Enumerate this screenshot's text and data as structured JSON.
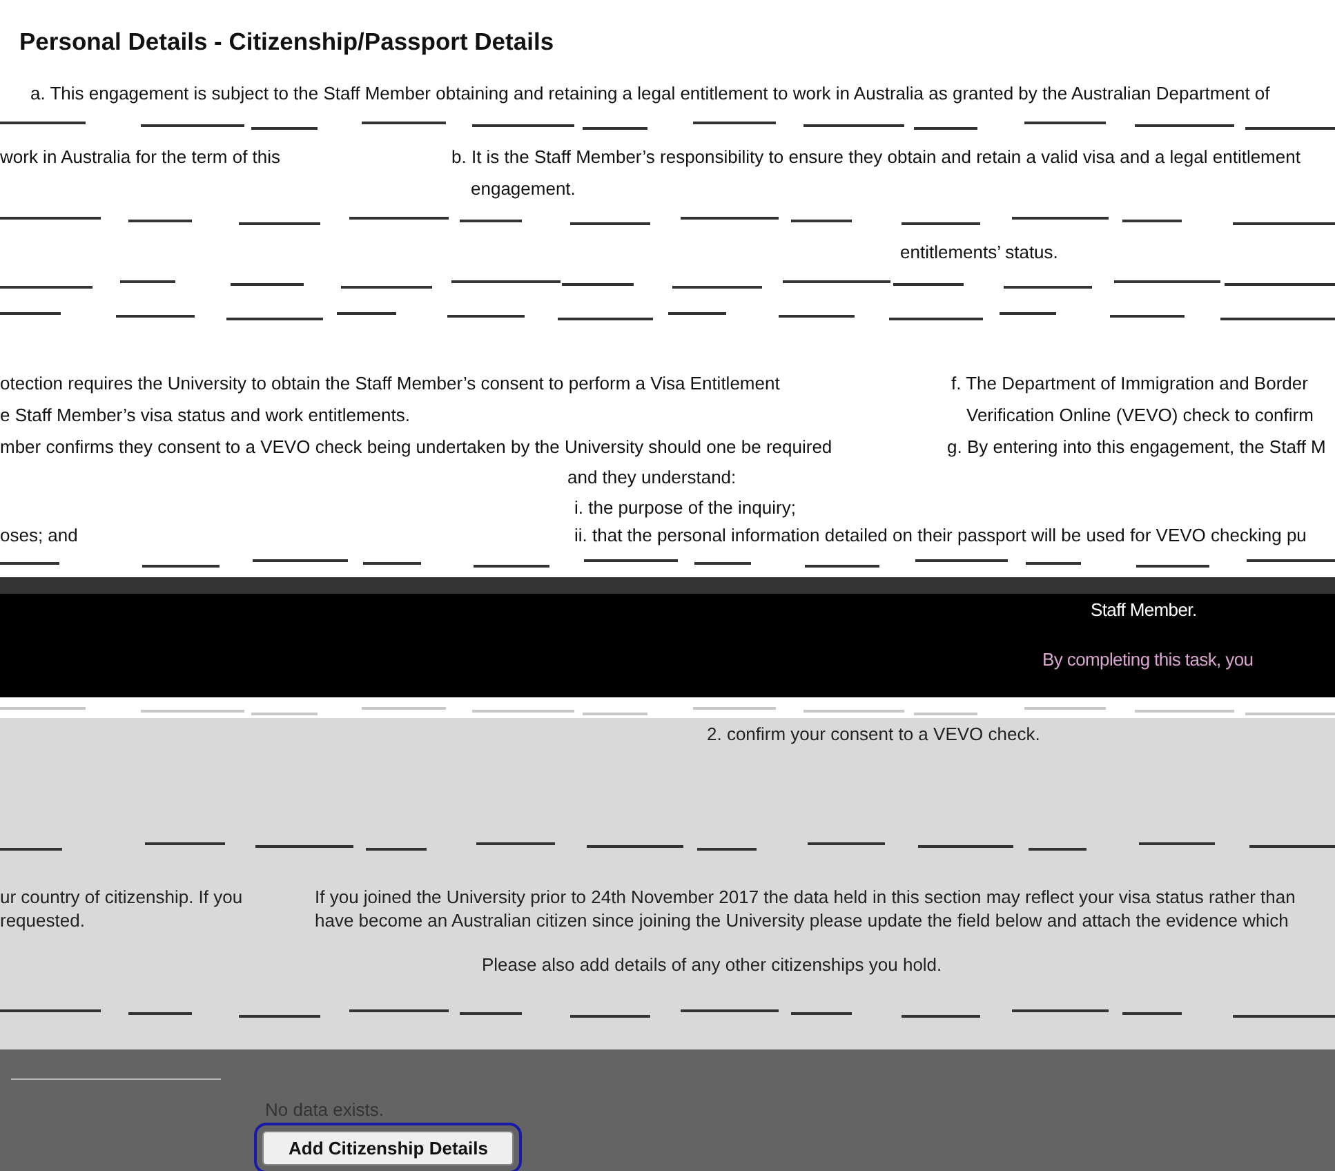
{
  "title": "Personal Details - Citizenship/Passport Details",
  "terms": [
    {
      "kind": "text",
      "segments": [
        "a. This engagement is subject to the Staff Member obtaining and retaining a legal entitlement to work in Australia as granted by the Australian Department of"
      ]
    },
    {
      "kind": "garbled"
    },
    {
      "kind": "text",
      "segments": [
        "work in Australia for the term of this",
        "b. It is the Staff Member’s responsibility to ensure they obtain and retain a valid visa and a legal entitlement"
      ]
    },
    {
      "kind": "text",
      "segments": [
        "engagement."
      ]
    },
    {
      "kind": "garbled"
    },
    {
      "kind": "text",
      "segments": [
        "entitlements’ status."
      ]
    },
    {
      "kind": "garbled"
    },
    {
      "kind": "garbled"
    },
    {
      "kind": "text",
      "segments": [
        "otection requires the University to obtain the Staff Member’s consent to perform a Visa Entitlement",
        "f. The Department of Immigration and Border"
      ]
    },
    {
      "kind": "text",
      "segments": [
        "e Staff Member’s visa status and work entitlements.",
        "Verification Online (VEVO) check to confirm"
      ]
    },
    {
      "kind": "text",
      "segments": [
        "mber confirms they consent to a VEVO check being undertaken by the University should one be required",
        "g. By entering into this engagement, the Staff M"
      ]
    },
    {
      "kind": "text",
      "segments": [
        "and they understand:"
      ]
    },
    {
      "kind": "text",
      "segments": [
        "i. the purpose of the inquiry;"
      ]
    },
    {
      "kind": "text",
      "segments": [
        "oses; and",
        "ii. that the personal information detailed on their passport will be used for VEVO checking pu"
      ]
    },
    {
      "kind": "garbled"
    }
  ],
  "band": [
    {
      "kind": "plain",
      "segments": [
        "Staff Member."
      ]
    },
    {
      "kind": "highlight",
      "segments": [
        "By completing this task, you"
      ]
    },
    {
      "kind": "garbled"
    }
  ],
  "info": [
    {
      "kind": "text",
      "segments": [
        "2. confirm your consent to a VEVO check."
      ]
    },
    {
      "kind": "garbled"
    },
    {
      "kind": "text",
      "segments": [
        "ur country of citizenship. If you",
        "If you joined the University prior to 24th November 2017 the data held in this section may reflect your visa status rather than"
      ]
    },
    {
      "kind": "text",
      "segments": [
        "requested.",
        "have become an Australian citizen since joining the University please update the field below and attach the evidence which"
      ]
    },
    {
      "kind": "text",
      "segments": [
        "Please also add details of any other citizenships you hold."
      ]
    },
    {
      "kind": "garbled"
    }
  ],
  "citizenships": {
    "empty_message": "No data exists.",
    "add_button": "Add Citizenship Details"
  }
}
